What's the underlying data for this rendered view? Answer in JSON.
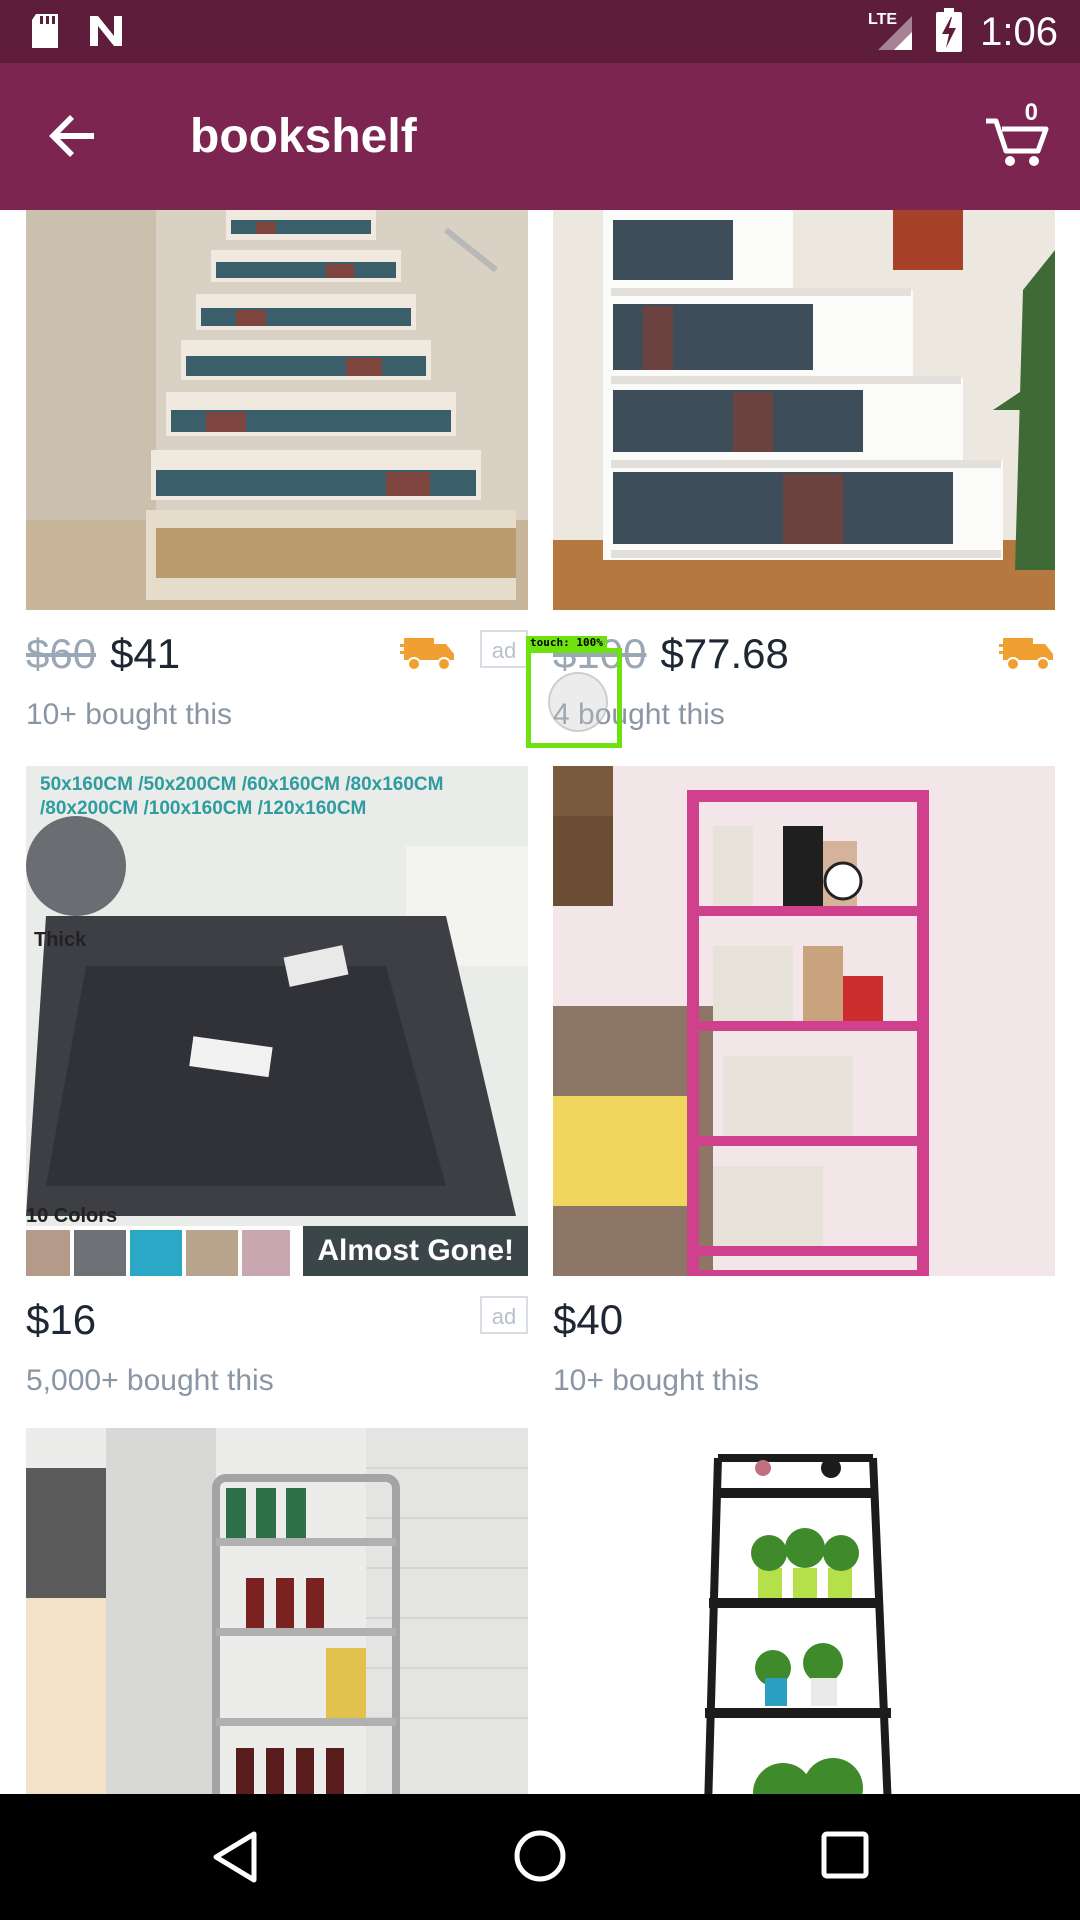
{
  "status_bar": {
    "time": "1:06",
    "network": "LTE"
  },
  "app_bar": {
    "title": "bookshelf",
    "cart_count": "0"
  },
  "products": [
    {
      "old_price": "$60",
      "price": "$41",
      "bought": "10+ bought this",
      "ad": "ad",
      "image": "staircase-bookshelf"
    },
    {
      "old_price": "$100",
      "price": "$77.68",
      "bought": "4 bought this",
      "ad": "",
      "image": "step-shelf"
    },
    {
      "old_price": "",
      "price": "$16",
      "bought": "5,000+ bought this",
      "ad": "ad",
      "image": "shaggy-rug",
      "rug_sizes_line1": "50x160CM /50x200CM /60x160CM /80x160CM",
      "rug_sizes_line2": "/80x200CM /100x160CM /120x160CM",
      "thick_label": "Thick",
      "colors_label": "10 Colors",
      "badge": "Almost Gone!"
    },
    {
      "old_price": "",
      "price": "$40",
      "bought": "10+ bought this",
      "ad": "",
      "image": "pink-shelf"
    },
    {
      "image": "rolling-cart"
    },
    {
      "image": "ladder-shelf"
    }
  ],
  "touch_overlay": {
    "label": "touch: 100%"
  },
  "colors": {
    "status_bar": "#5e1d3b",
    "app_bar": "#7b2550",
    "truck": "#f0a030"
  }
}
